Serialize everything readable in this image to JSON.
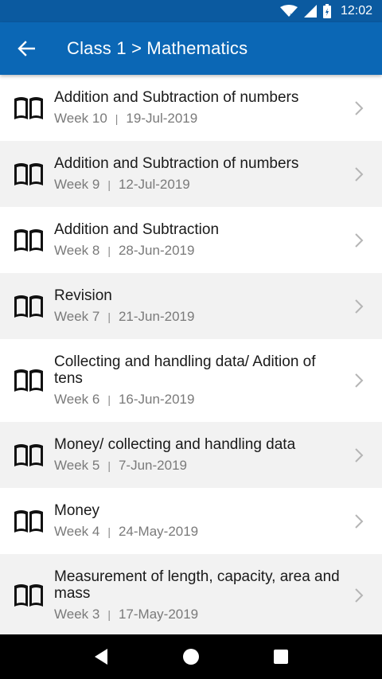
{
  "status_bar": {
    "time": "12:02",
    "icons": [
      "wifi-icon",
      "signal-icon",
      "battery-icon"
    ]
  },
  "app_bar": {
    "back_icon": "arrow-left-icon",
    "title": "Class 1 > Mathematics"
  },
  "list": {
    "items": [
      {
        "title": "Addition and Subtraction of numbers",
        "week": "Week 10",
        "separator": "|",
        "date": "19-Jul-2019"
      },
      {
        "title": "Addition and Subtraction of numbers",
        "week": "Week 9",
        "separator": "|",
        "date": "12-Jul-2019"
      },
      {
        "title": "Addition and Subtraction",
        "week": "Week 8",
        "separator": "|",
        "date": "28-Jun-2019"
      },
      {
        "title": "Revision",
        "week": "Week 7",
        "separator": "|",
        "date": "21-Jun-2019"
      },
      {
        "title": "Collecting and handling data/ Adition of tens",
        "week": "Week 6",
        "separator": "|",
        "date": "16-Jun-2019"
      },
      {
        "title": "Money/ collecting and handling data",
        "week": "Week 5",
        "separator": "|",
        "date": "7-Jun-2019"
      },
      {
        "title": "Money",
        "week": "Week 4",
        "separator": "|",
        "date": "24-May-2019"
      },
      {
        "title": "Measurement of length, capacity, area and mass",
        "week": "Week 3",
        "separator": "|",
        "date": "17-May-2019"
      }
    ]
  },
  "nav_bar": {
    "buttons": [
      "back-triangle-icon",
      "home-circle-icon",
      "recents-square-icon"
    ]
  },
  "colors": {
    "status_bar": "#0b5aa0",
    "app_bar": "#0b67b5",
    "alt_row": "#f2f2f2"
  }
}
